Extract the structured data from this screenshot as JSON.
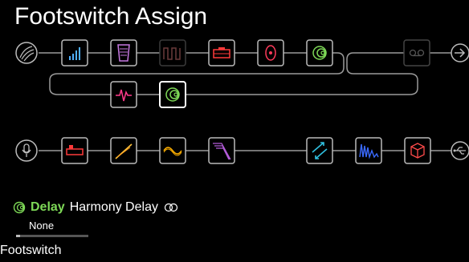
{
  "header": {
    "title": "Footswitch Assign"
  },
  "chain": {
    "path1": [
      {
        "id": "guitar-input-icon",
        "kind": "input"
      },
      {
        "id": "eq-graphic-icon",
        "kind": "block",
        "color": "#4fb0ff"
      },
      {
        "id": "volume-pedal-icon",
        "kind": "block",
        "color": "#c678e0"
      },
      {
        "id": "empty-slot-icon",
        "kind": "block",
        "color": "#6a3a3a"
      },
      {
        "id": "amp-head-icon",
        "kind": "block",
        "color": "#ff3a3a"
      },
      {
        "id": "speaker-cab-icon",
        "kind": "block",
        "color": "#ff3a5a"
      },
      {
        "id": "delay-icon",
        "kind": "block",
        "color": "#7ed957"
      },
      {
        "id": "looper-icon",
        "kind": "block",
        "color": "#555"
      },
      {
        "id": "output-arrow-icon",
        "kind": "output"
      }
    ],
    "path1b": [
      {
        "id": "synth-filter-icon",
        "kind": "block",
        "color": "#ff3a8a"
      },
      {
        "id": "harmony-delay-icon",
        "kind": "block",
        "color": "#7ed957",
        "selected": true
      }
    ],
    "path2": [
      {
        "id": "mic-input-icon",
        "kind": "input"
      },
      {
        "id": "preamp-icon",
        "kind": "block",
        "color": "#ff3a3a"
      },
      {
        "id": "distortion-icon",
        "kind": "block",
        "color": "#ffc23a"
      },
      {
        "id": "modulation-icon",
        "kind": "block",
        "color": "#ffb000"
      },
      {
        "id": "filter-icon",
        "kind": "block",
        "color": "#b25bd8"
      },
      {
        "id": "pitch-icon",
        "kind": "block",
        "color": "#30c0e0"
      },
      {
        "id": "wah-icon",
        "kind": "block",
        "color": "#3a6aff"
      },
      {
        "id": "cab-cube-icon",
        "kind": "block",
        "color": "#ff4a4a"
      },
      {
        "id": "usb-output-icon",
        "kind": "output"
      }
    ]
  },
  "info": {
    "category": "Delay",
    "model": "Harmony Delay",
    "category_color": "#7ed957",
    "footswitch_value": "None",
    "footswitch_fill": 0.05,
    "param_label": "Footswitch"
  }
}
